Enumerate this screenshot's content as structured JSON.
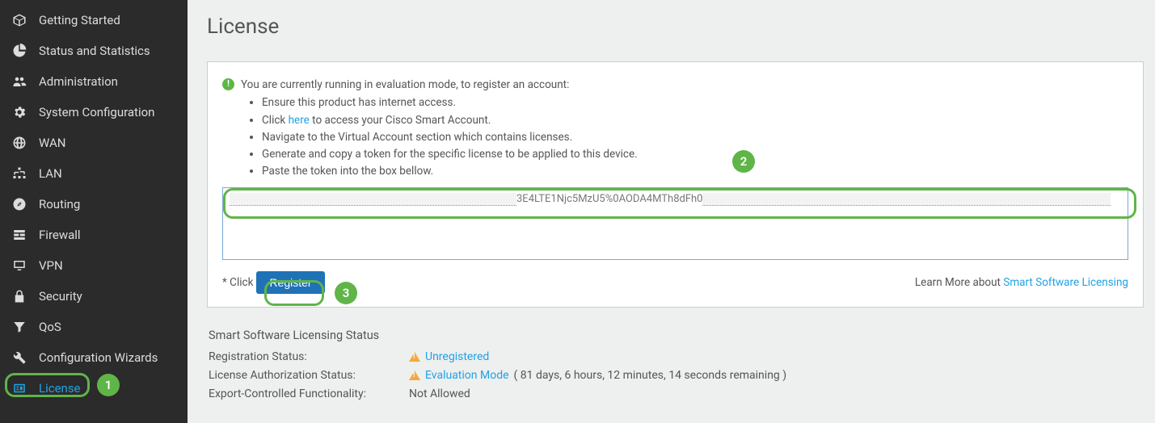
{
  "sidebar": {
    "items": [
      {
        "label": "Getting Started",
        "icon": "cube-icon"
      },
      {
        "label": "Status and Statistics",
        "icon": "piechart-icon"
      },
      {
        "label": "Administration",
        "icon": "users-icon"
      },
      {
        "label": "System Configuration",
        "icon": "gear-icon"
      },
      {
        "label": "WAN",
        "icon": "globe-icon"
      },
      {
        "label": "LAN",
        "icon": "sitemap-icon"
      },
      {
        "label": "Routing",
        "icon": "compass-icon"
      },
      {
        "label": "Firewall",
        "icon": "grid-icon"
      },
      {
        "label": "VPN",
        "icon": "monitor-icon"
      },
      {
        "label": "Security",
        "icon": "lock-icon"
      },
      {
        "label": "QoS",
        "icon": "filter-icon"
      },
      {
        "label": "Configuration Wizards",
        "icon": "wrench-icon"
      },
      {
        "label": "License",
        "icon": "id-card-icon",
        "active": true
      }
    ]
  },
  "page": {
    "title": "License"
  },
  "notice": {
    "lead": "You are currently running in evaluation mode, to register an account:",
    "items": [
      "Ensure this product has internet access.",
      "Click ",
      " to access your Cisco Smart Account.",
      "Navigate to the Virtual Account section which contains licenses.",
      "Generate and copy a token for the specific license to be applied to this device.",
      "Paste the token into the box bellow."
    ],
    "here_link": "here"
  },
  "token": {
    "visible_fragment": "3E4LTE1Njc5MzU5%0AODA4MTh8dFh0"
  },
  "register": {
    "prefix": "* Click",
    "button": "Register",
    "learn_more_label": "Learn More about ",
    "learn_more_link": "Smart Software Licensing"
  },
  "status": {
    "section_title": "Smart Software Licensing Status",
    "rows": {
      "registration": {
        "label": "Registration Status:",
        "value": "Unregistered"
      },
      "authorization": {
        "label": "License Authorization Status:",
        "value": "Evaluation Mode",
        "remaining": "( 81 days, 6 hours, 12 minutes, 14 seconds remaining )"
      },
      "export": {
        "label": "Export-Controlled Functionality:",
        "value": "Not Allowed"
      }
    }
  },
  "annotations": {
    "n1": "1",
    "n2": "2",
    "n3": "3"
  }
}
